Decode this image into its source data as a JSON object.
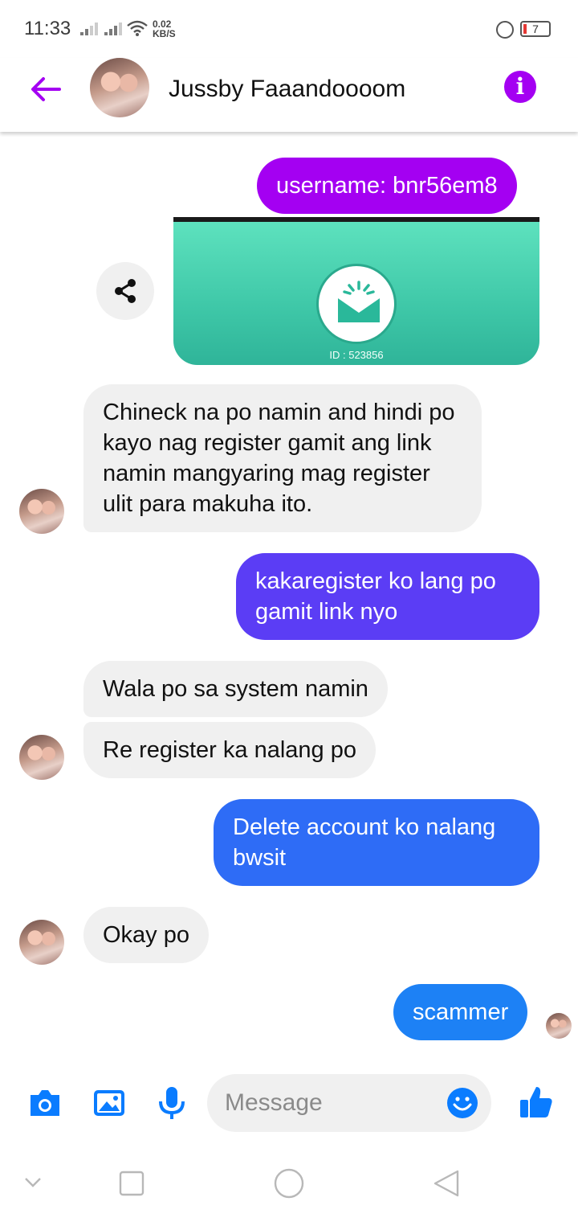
{
  "status_bar": {
    "time": "11:33",
    "net_speed_value": "0.02",
    "net_speed_unit": "KB/S",
    "battery": "7"
  },
  "header": {
    "contact_name": "Jussby Faaandoooom",
    "back_icon": "arrow-left-icon",
    "info_icon": "info-icon",
    "accent_color": "#a400f2"
  },
  "messages": [
    {
      "from": "me",
      "text": "username: bnr56em8",
      "color": "#a400f2"
    },
    {
      "from": "me",
      "type": "image",
      "caption": "ID : 523856"
    },
    {
      "from": "them",
      "text": "Chineck na po namin and  hindi po kayo nag register gamit ang link namin mangyaring mag register ulit para makuha ito."
    },
    {
      "from": "me",
      "text": "kakaregister ko lang po gamit link nyo",
      "color": "#5b3df5"
    },
    {
      "from": "them",
      "text": "Wala po sa system namin"
    },
    {
      "from": "them",
      "text": "Re register ka nalang po"
    },
    {
      "from": "me",
      "text": "Delete account ko nalang bwsit",
      "color": "#2e6cf6"
    },
    {
      "from": "them",
      "text": "Okay po"
    },
    {
      "from": "me",
      "text": "scammer",
      "color": "#1d81f5"
    }
  ],
  "composer": {
    "placeholder": "Message",
    "icons": [
      "camera-icon",
      "gallery-icon",
      "microphone-icon",
      "emoji-icon",
      "thumbs-up-icon"
    ],
    "accent_color": "#0a7cff"
  },
  "navbar": {
    "icons": [
      "chevron-down-icon",
      "square-icon",
      "home-circle-icon",
      "back-triangle-icon"
    ]
  }
}
